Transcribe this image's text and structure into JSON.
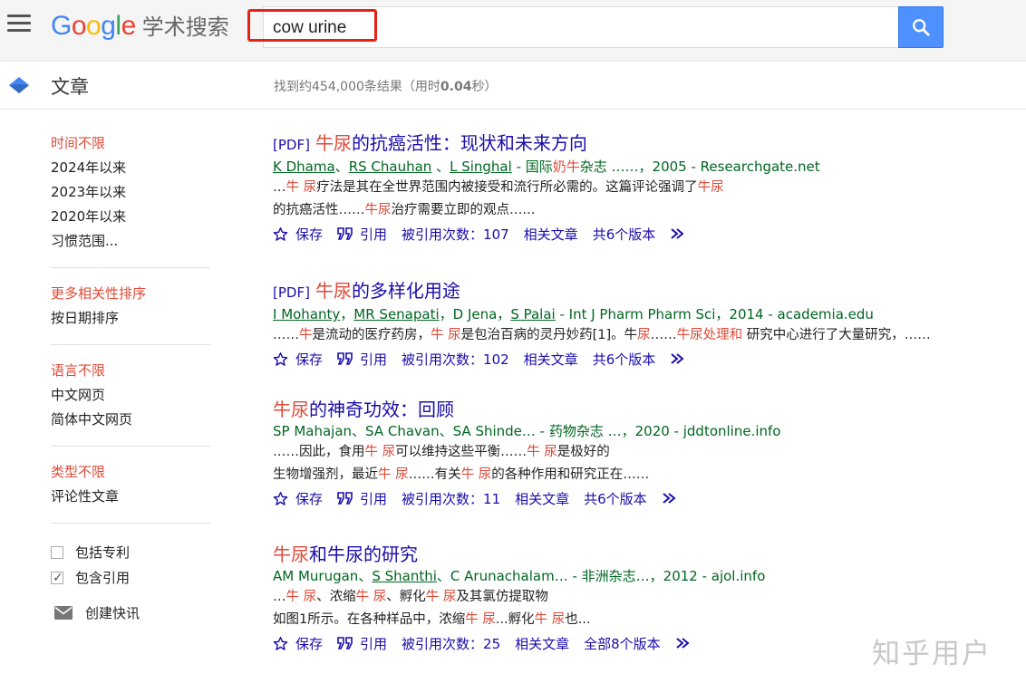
{
  "header": {
    "logo_google": "Google",
    "logo_sub": "学术搜索",
    "search_value": "cow urine"
  },
  "subbar": {
    "section_label": "文章",
    "stats_prefix": "找到约454,000条结果（用时",
    "stats_time": "0.04",
    "stats_suffix": "秒）"
  },
  "sidebar": {
    "time": [
      "时间不限",
      "2024年以来",
      "2023年以来",
      "2020年以来",
      "习惯范围..."
    ],
    "sort": [
      "更多相关性排序",
      "按日期排序"
    ],
    "lang": [
      "语言不限",
      "中文网页",
      "简体中文网页"
    ],
    "type": [
      "类型不限",
      "评论性文章"
    ],
    "include_patents": "包括专利",
    "include_citations": "包含引用",
    "create_alert": "创建快讯"
  },
  "results": [
    {
      "tag": "[PDF]",
      "title_hl": "牛尿",
      "title_rest": "的抗癌活性：现状和未来方向",
      "authors": [
        {
          "t": "K Dhama",
          "u": true
        },
        {
          "t": "、",
          "u": false
        },
        {
          "t": "RS Chauhan",
          "u": true
        },
        {
          "t": " 、",
          "u": false
        },
        {
          "t": "L Singhal",
          "u": true
        },
        {
          "t": " - 国际",
          "u": false
        },
        {
          "t": "奶牛",
          "hl": true
        },
        {
          "t": "杂志 ……，2005 - Researchgate.net",
          "u": false
        }
      ],
      "snippet": [
        [
          {
            "t": "…"
          },
          {
            "t": "牛 尿",
            "hl": true
          },
          {
            "t": "疗法是其在全世界范围内被接受和流行所必需的。这篇评论强调了"
          },
          {
            "t": "牛尿",
            "hl": true
          }
        ],
        [
          {
            "t": "的抗癌活性……"
          },
          {
            "t": "牛尿",
            "hl": true
          },
          {
            "t": "治疗需要立即的观点…..."
          }
        ]
      ],
      "save": "保存",
      "cite": "引用",
      "cited_by": "被引用次数：107",
      "related": "相关文章",
      "versions": "共6个版本"
    },
    {
      "tag": "[PDF]",
      "title_hl": "牛尿",
      "title_rest": "的多样化用途",
      "authors": [
        {
          "t": "I Mohanty",
          "u": true
        },
        {
          "t": "，",
          "u": false
        },
        {
          "t": "MR Senapati",
          "u": true
        },
        {
          "t": "，D Jena，",
          "u": false
        },
        {
          "t": "S Palai",
          "u": true
        },
        {
          "t": "  - Int J Pharm Pharm Sci，2014 - academia.edu",
          "u": false
        }
      ],
      "snippet": [
        [
          {
            "t": "……"
          },
          {
            "t": "牛",
            "hl": true
          },
          {
            "t": "是流动的医疗药房，"
          },
          {
            "t": "牛 尿",
            "hl": true
          },
          {
            "t": "是包治百病的灵丹妙药[1]。牛"
          },
          {
            "t": "尿",
            "hl": true
          },
          {
            "t": "……"
          },
          {
            "t": "牛尿处理和",
            "hl": true
          },
          {
            "t": " 研究中心进行了大量研究，……"
          }
        ]
      ],
      "save": "保存",
      "cite": "引用",
      "cited_by": "被引用次数：102",
      "related": "相关文章",
      "versions": "共6个版本"
    },
    {
      "tag": "",
      "title_hl": "牛尿",
      "title_rest": "的神奇功效：回顾",
      "authors": [
        {
          "t": "SP Mahajan、SA Chavan、SA Shinde… - 药物杂志 …，2020 - jddtonline.info",
          "u": false
        }
      ],
      "snippet": [
        [
          {
            "t": "……因此，食用"
          },
          {
            "t": "牛 尿",
            "hl": true
          },
          {
            "t": "可以维持这些平衡……"
          },
          {
            "t": "牛 尿",
            "hl": true
          },
          {
            "t": "是极好的"
          }
        ],
        [
          {
            "t": "生物增强剂，最近"
          },
          {
            "t": "牛 尿",
            "hl": true
          },
          {
            "t": "……有关"
          },
          {
            "t": "牛 尿",
            "hl": true
          },
          {
            "t": "的各种作用和研究正在……"
          }
        ]
      ],
      "save": "保存",
      "cite": "引用",
      "cited_by": "被引用次数：11",
      "related": "相关文章",
      "versions": "共6个版本"
    },
    {
      "tag": "",
      "title_hl": "牛尿",
      "title_rest": "和牛尿的研究",
      "authors": [
        {
          "t": "AM Murugan、",
          "u": false
        },
        {
          "t": "S Shanthi",
          "u": true
        },
        {
          "t": "、C Arunachalam… - 非洲杂志…，2012 - ajol.info",
          "u": false
        }
      ],
      "snippet": [
        [
          {
            "t": "…"
          },
          {
            "t": "牛 尿",
            "hl": true
          },
          {
            "t": "、浓缩"
          },
          {
            "t": "牛 尿",
            "hl": true
          },
          {
            "t": "、孵化"
          },
          {
            "t": "牛 尿",
            "hl": true
          },
          {
            "t": "及其氯仿提取物"
          }
        ],
        [
          {
            "t": "如图1所示。在各种样品中，浓缩"
          },
          {
            "t": "牛 尿",
            "hl": true
          },
          {
            "t": "...孵化"
          },
          {
            "t": "牛 尿",
            "hl": true
          },
          {
            "t": "也..."
          }
        ]
      ],
      "save": "保存",
      "cite": "引用",
      "cited_by": "被引用次数：25",
      "related": "相关文章",
      "versions": "全部8个版本"
    }
  ],
  "watermark": "知乎用户",
  "colors": {
    "highlight_box": "#e62117",
    "link": "#1a0dab",
    "accent_red": "#dd4b39",
    "author_green": "#006621",
    "search_btn": "#4d90fe"
  }
}
